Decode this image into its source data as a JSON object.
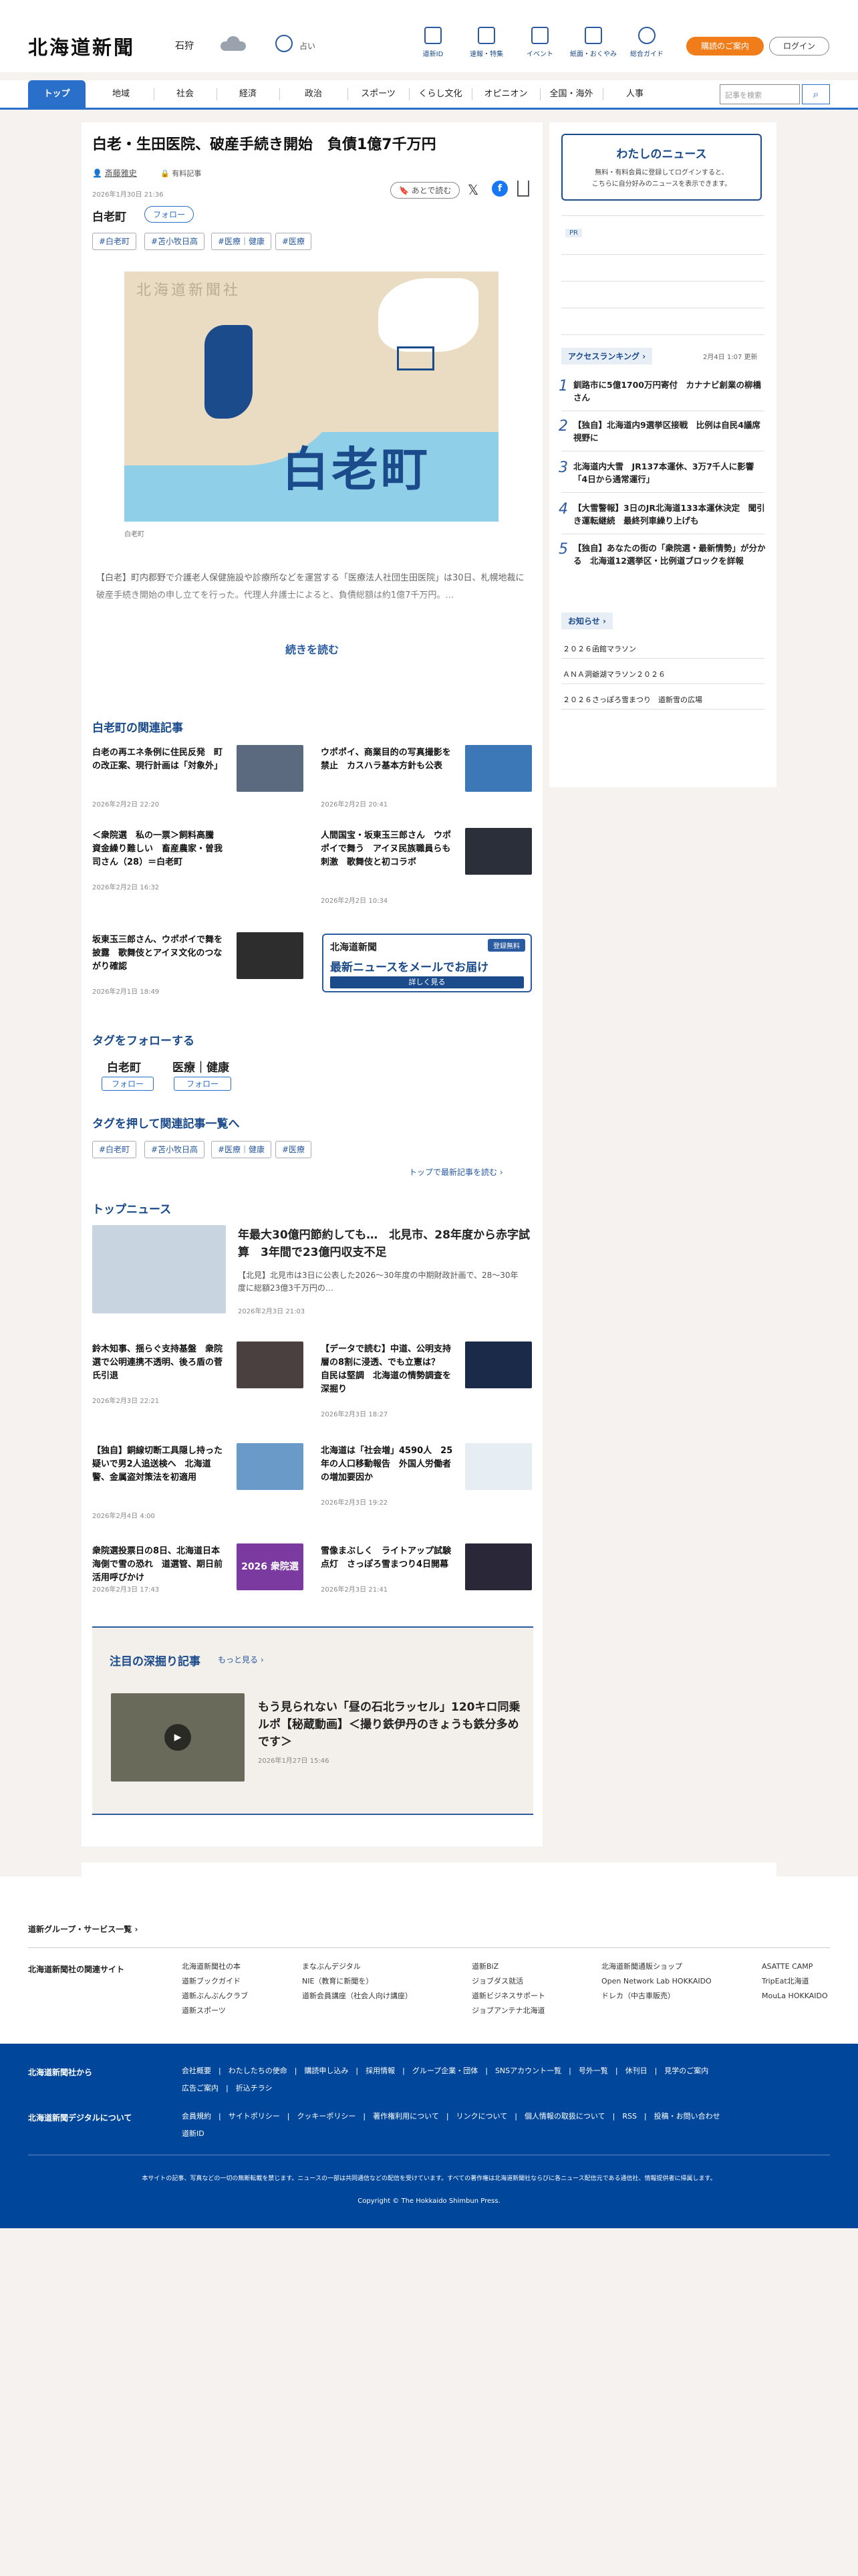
{
  "header": {
    "logo": "北海道新聞",
    "location": "石狩",
    "weather_label": "占い",
    "icons": [
      "道新ID",
      "速報・特集",
      "イベント",
      "紙面・おくやみ",
      "総合ガイド"
    ],
    "subscribe": "購読のご案内",
    "login": "ログイン"
  },
  "nav": {
    "items": [
      "トップ",
      "地域",
      "社会",
      "経済",
      "政治",
      "スポーツ",
      "くらし文化",
      "オピニオン",
      "全国・海外",
      "人事"
    ],
    "search_placeholder": "記事を検索"
  },
  "article": {
    "title": "白老・生田医院、破産手続き開始　負債1億7千万円",
    "author": "斎藤雅史",
    "author_tag": "有料記事",
    "date": "2026年1月30日 21:36",
    "place": "白老町",
    "follow": "フォロー",
    "save": "あとで読む",
    "tags": [
      "#白老町",
      "#苫小牧日高",
      "#医療｜健康",
      "#医療"
    ],
    "map_title": "白老町",
    "map_watermark": "北海道新聞社",
    "caption": "白老町",
    "lead": "【白老】町内郡野で介護老人保健施設や診療所などを運営する「医療法人社団生田医院」は30日、札幌地裁に破産手続き開始の申し立てを行った。代理人弁護士によると、負債総額は約1億7千万円。…",
    "read_more": "続きを読む"
  },
  "related": {
    "heading": "白老町の関連記事",
    "items": [
      {
        "title": "白老の再エネ条例に住民反発　町の改正案、現行計画は「対象外」",
        "date": "2026年2月2日 22:20"
      },
      {
        "title": "ウポポイ、商業目的の写真撮影を禁止　カスハラ基本方針も公表",
        "date": "2026年2月2日 20:41"
      },
      {
        "title": "＜衆院選　私の一票＞飼料高騰　資金繰り難しい　畜産農家・曽我司さん（28）＝白老町",
        "date": "2026年2月2日 16:32"
      },
      {
        "title": "人間国宝・坂東玉三郎さん　ウポポイで舞う　アイヌ民族職員らも刺激　歌舞伎と初コラボ",
        "date": "2026年2月2日 10:34"
      },
      {
        "title": "坂東玉三郎さん、ウポポイで舞を披露　歌舞伎とアイヌ文化のつながり確認",
        "date": "2026年2月1日 18:49"
      }
    ],
    "promo": {
      "logo": "北海道新聞",
      "badge": "登録無料",
      "headline": "最新ニュースをメールでお届け",
      "button": "詳しく見る"
    }
  },
  "follow_tags": {
    "heading": "タグをフォローする",
    "items": [
      {
        "name": "白老町",
        "btn": "フォロー"
      },
      {
        "name": "医療｜健康",
        "btn": "フォロー"
      }
    ]
  },
  "tag_list": {
    "heading": "タグを押して関連記事一覧へ",
    "tags": [
      "#白老町",
      "#苫小牧日高",
      "#医療｜健康",
      "#医療"
    ],
    "back": "トップで最新記事を読む"
  },
  "top_news": {
    "heading": "トップニュース",
    "lead": {
      "title": "年最大30億円節約しても…　北見市、28年度から赤字試算　3年間で23億円収支不足",
      "summary": "【北見】北見市は3日に公表した2026〜30年度の中期財政計画で、28〜30年度に総額23億3千万円の…",
      "date": "2026年2月3日 21:03"
    },
    "items": [
      {
        "title": "鈴木知事、揺らぐ支持基盤　衆院選で公明連携不透明、後ろ盾の菅氏引退",
        "date": "2026年2月3日 22:21"
      },
      {
        "title": "【データで読む】中道、公明支持層の8割に浸透、でも立憲は？　自民は堅調　北海道の情勢調査を深掘り",
        "date": "2026年2月3日 18:27"
      },
      {
        "title": "【独自】銅線切断工具隠し持った疑いで男2人追送検へ　北海道警、金属盗対策法を初適用",
        "date": "2026年2月4日 4:00"
      },
      {
        "title": "北海道は「社会増」4590人　25年の人口移動報告　外国人労働者の増加要因か",
        "date": "2026年2月3日 19:22"
      },
      {
        "title": "衆院選投票日の8日、北海道日本海側で雪の恐れ　道選管、期日前活用呼びかけ",
        "date": "2026年2月3日 17:43"
      },
      {
        "title": "雪像まぶしく　ライトアップ試験点灯　さっぽろ雪まつり4日開幕",
        "date": "2026年2月3日 21:41"
      }
    ],
    "thumb_badge": "2026 衆院選"
  },
  "deep": {
    "heading": "注目の深掘り記事",
    "more": "もっと見る",
    "title": "もう見られない「昼の石北ラッセル」120キロ同乗ルポ【秘蔵動画】＜撮り鉄伊丹のきょうも鉄分多めです＞",
    "date": "2026年1月27日 15:46"
  },
  "sidebar": {
    "mynews": {
      "title": "わたしのニュース",
      "text1": "無料・有料会員に登録してログインすると、",
      "text2": "こちらに自分好みのニュースを表示できます。"
    },
    "pr": "PR",
    "ranking": {
      "heading": "アクセスランキング",
      "updated": "2月4日 1:07 更新",
      "items": [
        "釧路市に5億1700万円寄付　カナナビ創業の柳橋さん",
        "【独自】北海道内9選挙区接戦　比例は自民4議席視野に",
        "北海道内大雪　JR137本運休、3万7千人に影響　「4日から通常運行」",
        "【大雪警報】3日のJR北海道133本運休決定　聞引き運転継続　最終列車繰り上げも",
        "【独自】あなたの街の「衆院選・最新情勢」が分かる　北海道12選挙区・比例道ブロックを詳報"
      ]
    },
    "notice": {
      "heading": "お知らせ",
      "items": [
        "２０２６函館マラソン",
        "ＡＮＡ洞爺湖マラソン２０２６",
        "２０２６さっぽろ雪まつり　道新雪の広場"
      ]
    }
  },
  "footer": {
    "group_link": "道新グループ・サービス一覧",
    "related_label": "北海道新聞社の関連サイト",
    "cols": [
      [
        "北海道新聞社の本",
        "道新ブックガイド",
        "道新ぶんぶんクラブ",
        "道新スポーツ"
      ],
      [
        "まなぶんデジタル",
        "NIE（教育に新聞を）",
        "道新会員講座（社会人向け講座）"
      ],
      [
        "道新BiZ",
        "ジョブダス就活",
        "道新ビジネスサポート",
        "ジョブアンテナ北海道"
      ],
      [
        "北海道新聞通販ショップ",
        "Open Network Lab HOKKAIDO",
        "ドレカ（中古車販売）"
      ],
      [
        "ASATTE CAMP",
        "TripEat北海道",
        "MouLa HOKKAIDO"
      ]
    ],
    "from_label": "北海道新聞社から",
    "from_links": [
      "会社概要",
      "わたしたちの使命",
      "購読申し込み",
      "採用情報",
      "グループ企業・団体",
      "SNSアカウント一覧",
      "号外一覧",
      "休刊日",
      "見学のご案内",
      "広告ご案内",
      "折込チラシ"
    ],
    "digital_label": "北海道新聞デジタルについて",
    "digital_links": [
      "会員規約",
      "サイトポリシー",
      "クッキーポリシー",
      "著作権利用について",
      "リンクについて",
      "個人情報の取扱について",
      "RSS",
      "投稿・お問い合わせ",
      "道新ID"
    ],
    "notice": "本サイトの記事、写真などの一切の無断転載を禁じます。ニュースの一部は共同通信などの配信を受けています。すべての著作権は北海道新聞社ならびに各ニュース配信元である通信社、情報提供者に帰属します。",
    "copyright": "Copyright © The Hokkaido Shimbun Press."
  },
  "colors": {
    "brand_blue": "#2a6fc9",
    "accent_orange": "#f07d1a",
    "footer_blue": "#00469b"
  }
}
